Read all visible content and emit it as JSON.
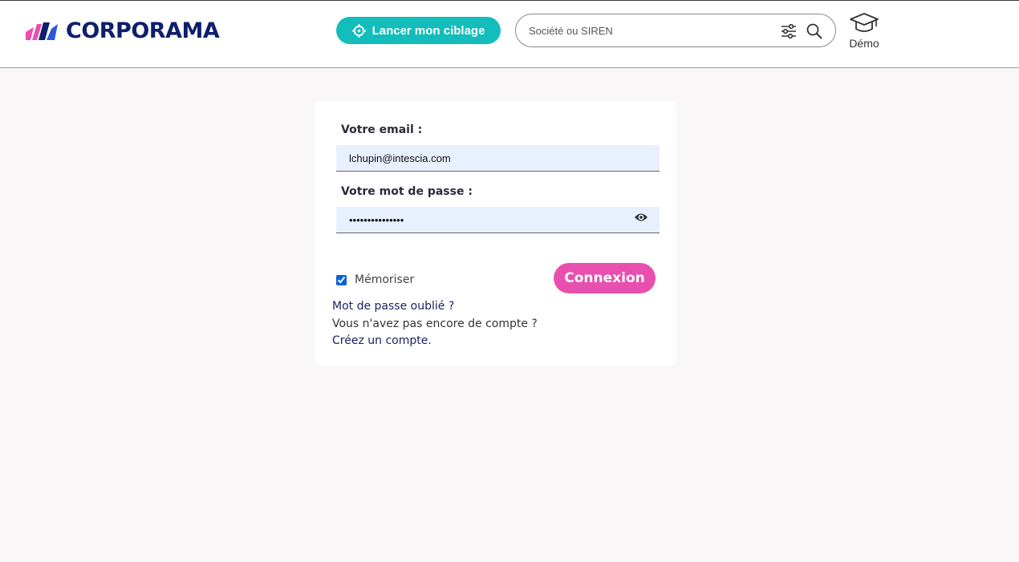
{
  "header": {
    "brand": "CORPORAMA",
    "target_button": "Lancer mon ciblage",
    "search": {
      "placeholder": "Société ou SIREN",
      "value": ""
    },
    "demo_label": "Démo"
  },
  "login": {
    "email_label": "Votre email :",
    "email_value": "lchupin@intescia.com",
    "password_label": "Votre mot de passe :",
    "password_value": "•••••••••••••••",
    "remember_label": "Mémoriser",
    "remember_checked": true,
    "submit_label": "Connexion",
    "forgot_link": "Mot de passe oublié ?",
    "no_account_text": "Vous n'avez pas encore de compte ?",
    "create_link": "Créez un compte."
  },
  "colors": {
    "brand_navy": "#0d1f6b",
    "teal": "#13bdbb",
    "pink": "#e94fae",
    "input_bg": "#e8f0fe",
    "page_bg": "#f9f7f7"
  },
  "icons": [
    "logo-mark",
    "target-icon",
    "filter-icon",
    "search-icon",
    "graduation-cap-icon",
    "eye-icon"
  ]
}
